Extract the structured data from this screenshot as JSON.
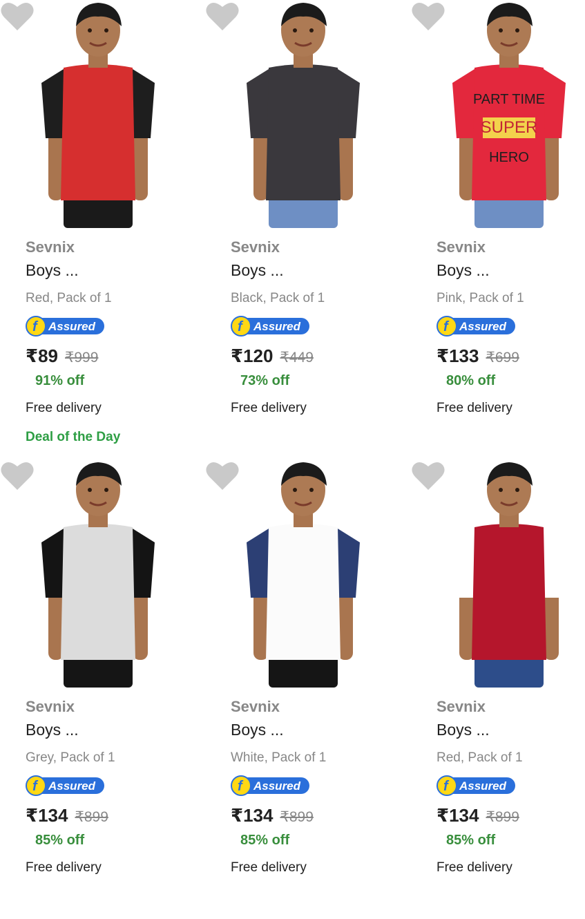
{
  "products": [
    {
      "brand": "Sevnix",
      "title": "Boys ...",
      "variant": "Red, Pack of 1",
      "assured": "Assured",
      "price": "₹89",
      "mrp": "₹999",
      "off": "91% off",
      "delivery": "Free delivery",
      "deal": "Deal of the Day",
      "shirt": "#d62f2f",
      "sleeve": "#1e1e1e",
      "pants": "#1a1a1a"
    },
    {
      "brand": "Sevnix",
      "title": "Boys ...",
      "variant": "Black, Pack of 1",
      "assured": "Assured",
      "price": "₹120",
      "mrp": "₹449",
      "off": "73% off",
      "delivery": "Free delivery",
      "deal": "",
      "shirt": "#3a383d",
      "sleeve": "#3a383d",
      "pants": "#6e8fc4"
    },
    {
      "brand": "Sevnix",
      "title": "Boys ...",
      "variant": "Pink, Pack of 1",
      "assured": "Assured",
      "price": "₹133",
      "mrp": "₹699",
      "off": "80% off",
      "delivery": "Free delivery",
      "deal": "",
      "shirt": "#e3283d",
      "sleeve": "#e3283d",
      "pants": "#6e8fc4"
    },
    {
      "brand": "Sevnix",
      "title": "Boys ...",
      "variant": "Grey, Pack of 1",
      "assured": "Assured",
      "price": "₹134",
      "mrp": "₹899",
      "off": "85% off",
      "delivery": "Free delivery",
      "deal": "",
      "shirt": "#dcdcdc",
      "sleeve": "#141414",
      "pants": "#151515"
    },
    {
      "brand": "Sevnix",
      "title": "Boys ...",
      "variant": "White, Pack of 1",
      "assured": "Assured",
      "price": "₹134",
      "mrp": "₹899",
      "off": "85% off",
      "delivery": "Free delivery",
      "deal": "",
      "shirt": "#fbfbfb",
      "sleeve": "#2c3f74",
      "pants": "#151515"
    },
    {
      "brand": "Sevnix",
      "title": "Boys ...",
      "variant": "Red, Pack of 1",
      "assured": "Assured",
      "price": "₹134",
      "mrp": "₹899",
      "off": "85% off",
      "delivery": "Free delivery",
      "deal": "",
      "shirt": "#b5162c",
      "sleeve": "#ffffff",
      "pants": "#2d4d8a"
    }
  ],
  "print_text": [
    "PART TIME",
    "SUPER",
    "HERO"
  ],
  "colors": {
    "heart": "#c9c9c9",
    "assured_blue": "#2a6fdb",
    "assured_yellow": "#ffd814",
    "offer_green": "#388e3c"
  },
  "icons": {
    "wishlist": "heart-icon",
    "assured": "flipkart-assured-badge"
  }
}
